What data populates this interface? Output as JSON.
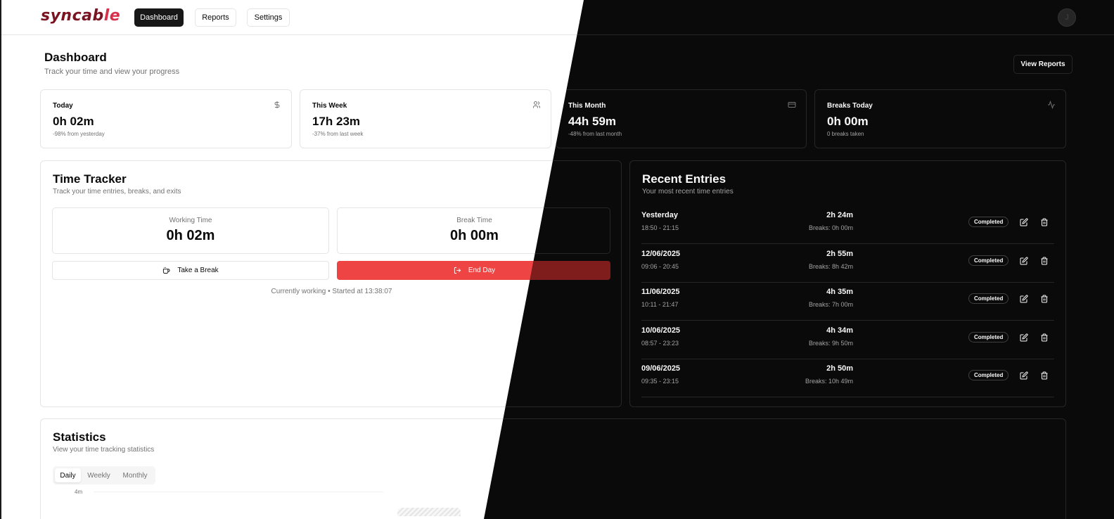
{
  "header": {
    "logo_text_a": "syncab",
    "logo_text_b": "le",
    "nav": [
      "Dashboard",
      "Reports",
      "Settings"
    ],
    "avatar_initial": "J"
  },
  "page": {
    "title": "Dashboard",
    "subtitle": "Track your time and view your progress",
    "view_reports": "View Reports"
  },
  "stats": [
    {
      "label": "Today",
      "value": "0h 02m",
      "sub": "-98% from yesterday",
      "icon": "dollar-icon"
    },
    {
      "label": "This Week",
      "value": "17h 23m",
      "sub": "-37% from last week",
      "icon": "users-icon"
    },
    {
      "label": "This Month",
      "value": "44h 59m",
      "sub": "-48% from last month",
      "icon": "credit-card-icon"
    },
    {
      "label": "Breaks Today",
      "value": "0h 00m",
      "sub": "0 breaks taken",
      "icon": "activity-icon"
    }
  ],
  "tracker": {
    "title": "Time Tracker",
    "subtitle": "Track your time entries, breaks, and exits",
    "working_label": "Working Time",
    "working_value": "0h 02m",
    "break_label": "Break Time",
    "break_value": "0h 00m",
    "take_break": "Take a Break",
    "end_day": "End Day",
    "status": "Currently working • Started at 13:38:07"
  },
  "recent": {
    "title": "Recent Entries",
    "subtitle": "Your most recent time entries",
    "entries": [
      {
        "date": "Yesterday",
        "range": "18:50 - 21:15",
        "duration": "2h 24m",
        "breaks": "Breaks: 0h 00m",
        "status": "Completed"
      },
      {
        "date": "12/06/2025",
        "range": "09:06 - 20:45",
        "duration": "2h 55m",
        "breaks": "Breaks: 8h 42m",
        "status": "Completed"
      },
      {
        "date": "11/06/2025",
        "range": "10:11 - 21:47",
        "duration": "4h 35m",
        "breaks": "Breaks: 7h 00m",
        "status": "Completed"
      },
      {
        "date": "10/06/2025",
        "range": "08:57 - 23:23",
        "duration": "4h 34m",
        "breaks": "Breaks: 9h 50m",
        "status": "Completed"
      },
      {
        "date": "09/06/2025",
        "range": "09:35 - 23:15",
        "duration": "2h 50m",
        "breaks": "Breaks: 10h 49m",
        "status": "Completed"
      }
    ]
  },
  "statistics": {
    "title": "Statistics",
    "subtitle": "View your time tracking statistics",
    "tabs": [
      "Daily",
      "Weekly",
      "Monthly"
    ],
    "active_tab": "Daily",
    "y_tick": "4m"
  },
  "colors": {
    "accent_red": "#ef4444",
    "brand": "#7a1422",
    "dark_bg": "#0a0a0a"
  }
}
